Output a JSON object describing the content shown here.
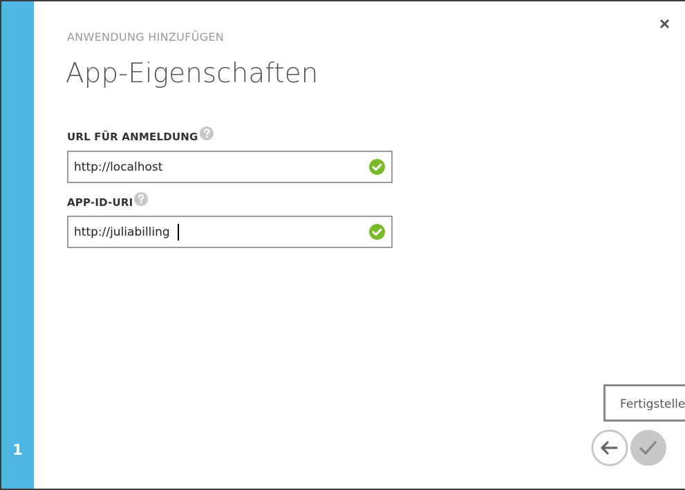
{
  "wizard": {
    "step_number": "1",
    "subtitle": "ANWENDUNG HINZUFÜGEN",
    "title": "App-Eigenschaften",
    "accent_color": "#4fb6e3"
  },
  "fields": [
    {
      "label": "URL FÜR ANMELDUNG",
      "value": "http://localhost",
      "valid": true
    },
    {
      "label": "APP-ID-URI",
      "value": "http://juliabilling",
      "valid": true
    }
  ],
  "tooltip": {
    "text": "Fertigstellen"
  },
  "icons": {
    "close": "close-icon",
    "help": "help-icon",
    "valid": "checkmark-circle-icon",
    "back": "arrow-left-icon",
    "finish": "checkmark-icon"
  },
  "colors": {
    "valid_green": "#7ab929",
    "help_gray": "#c8c8c8",
    "border_gray": "#9a9a9a"
  }
}
